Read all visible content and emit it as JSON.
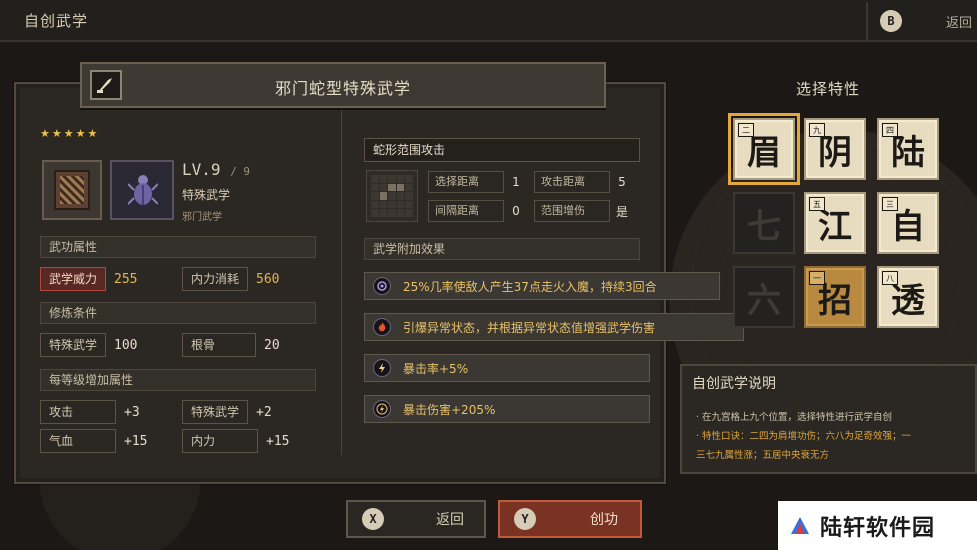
{
  "topbar": {
    "title": "自创武学",
    "back_key": "B",
    "back_label": "返回"
  },
  "skill": {
    "name": "邪门蛇型特殊武学",
    "stars": "★★★★★",
    "level_prefix": "LV.",
    "level": "9",
    "level_max": "/ 9",
    "type": "特殊武学",
    "subtype": "邪门武学"
  },
  "attributes": {
    "header": "武功属性",
    "power_label": "武学威力",
    "power_value": "255",
    "cost_label": "内力消耗",
    "cost_value": "560"
  },
  "requirements": {
    "header": "修炼条件",
    "req1_label": "特殊武学",
    "req1_value": "100",
    "req2_label": "根骨",
    "req2_value": "20"
  },
  "per_level": {
    "header": "每等级增加属性",
    "items": [
      {
        "label": "攻击",
        "value": "+3"
      },
      {
        "label": "特殊武学",
        "value": "+2"
      },
      {
        "label": "气血",
        "value": "+15"
      },
      {
        "label": "内力",
        "value": "+15"
      }
    ]
  },
  "attack": {
    "name": "蛇形范围攻击",
    "select_dist_label": "选择距离",
    "select_dist_value": "1",
    "attack_dist_label": "攻击距离",
    "attack_dist_value": "5",
    "interval_label": "间隔距离",
    "interval_value": "0",
    "range_inc_label": "范围增伤",
    "range_inc_value": "是"
  },
  "effects": {
    "header": "武学附加效果",
    "items": [
      {
        "icon": "spiral-icon",
        "text": "25%几率使敌人产生37点走火入魔，持续3回合"
      },
      {
        "icon": "fire-icon",
        "text": "引爆异常状态，并根据异常状态值增强武学伤害"
      },
      {
        "icon": "lightning-icon",
        "text": "暴击率+5%"
      },
      {
        "icon": "lightning-burst-icon",
        "text": "暴击伤害+205%"
      }
    ]
  },
  "traits": {
    "title": "选择特性",
    "tiles": [
      {
        "num": "二",
        "char": "眉",
        "state": "selected"
      },
      {
        "num": "九",
        "char": "阴",
        "state": "normal"
      },
      {
        "num": "四",
        "char": "陆",
        "state": "normal"
      },
      {
        "num": "",
        "char": "七",
        "state": "dim"
      },
      {
        "num": "五",
        "char": "江",
        "state": "normal"
      },
      {
        "num": "三",
        "char": "自",
        "state": "normal"
      },
      {
        "num": "",
        "char": "六",
        "state": "dim"
      },
      {
        "num": "一",
        "char": "招",
        "state": "gold"
      },
      {
        "num": "八",
        "char": "透",
        "state": "normal"
      }
    ]
  },
  "description": {
    "title": "自创武学说明",
    "line1": "· 在九宫格上九个位置，选择特性进行武学自创",
    "line2": "· 特性口诀：二四为肩增功伤；六八为足奇效强；一",
    "line3": "三七九属性涨；五居中央衰无方"
  },
  "buttons": {
    "back_key": "X",
    "back_label": "返回",
    "create_key": "Y",
    "create_label": "创功"
  },
  "watermark": {
    "text": "陆轩软件园"
  },
  "colors": {
    "accent_gold": "#e8c165",
    "highlight_red": "#b0463c",
    "primary_button": "#7a3323"
  }
}
